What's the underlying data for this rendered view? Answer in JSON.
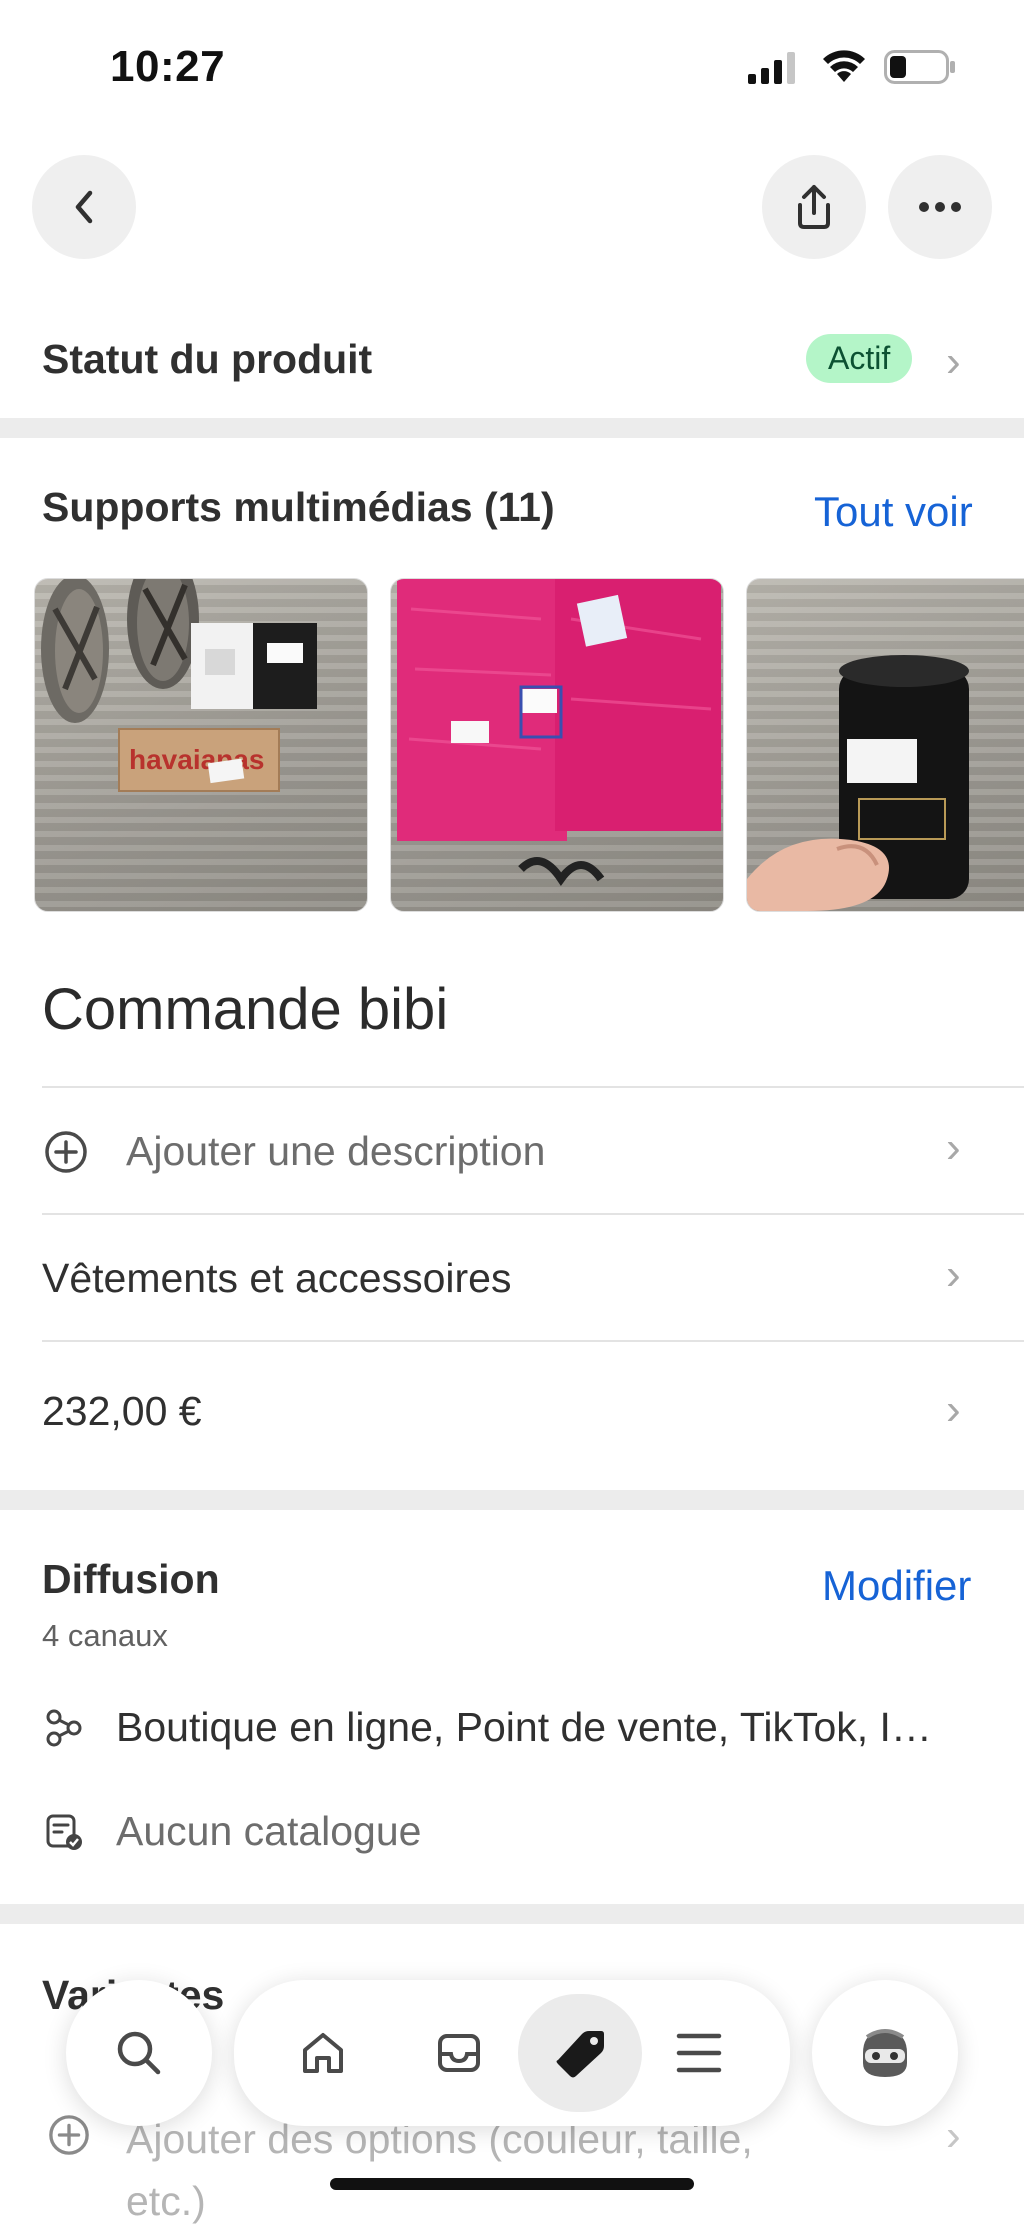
{
  "status_bar": {
    "time": "10:27"
  },
  "product_status": {
    "label": "Statut du produit",
    "badge": "Actif"
  },
  "media": {
    "title": "Supports multimédias (11)",
    "see_all": "Tout voir",
    "thumb1_brand": "havaianas"
  },
  "product": {
    "title": "Commande bibi",
    "add_description": "Ajouter une description",
    "category": "Vêtements et accessoires",
    "price": "232,00 €"
  },
  "distribution": {
    "title": "Diffusion",
    "subtitle": "4 canaux",
    "edit": "Modifier",
    "channels": "Boutique en ligne, Point de vente, TikTok, I…",
    "catalog": "Aucun catalogue"
  },
  "variants": {
    "title": "Variantes",
    "add_options": "Ajouter des options (couleur, taille, etc.)"
  },
  "colors": {
    "accent": "#1663d6",
    "badge_bg": "#b4f5c8",
    "badge_text": "#0c5132"
  }
}
